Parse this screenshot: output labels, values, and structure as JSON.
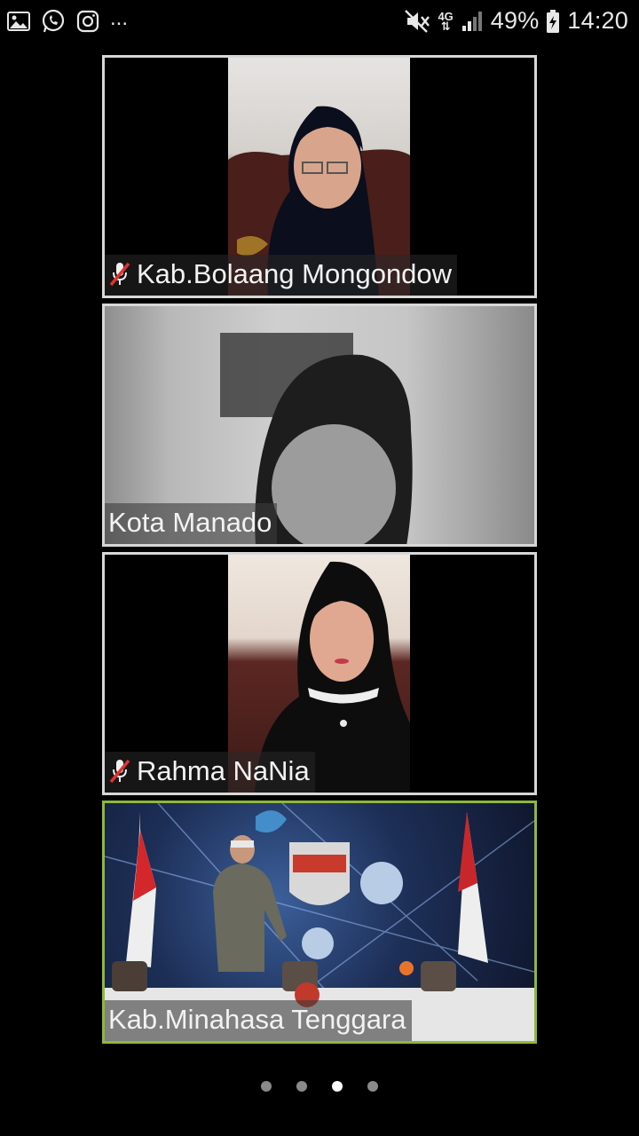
{
  "status_bar": {
    "left_icons": [
      "gallery-icon",
      "whatsapp-icon",
      "instagram-icon"
    ],
    "more": "...",
    "network": "4G",
    "battery": "49%",
    "time": "14:20"
  },
  "participants": [
    {
      "name": "Kab.Bolaang Mongondow",
      "muted": true,
      "active": false
    },
    {
      "name": "Kota Manado",
      "muted": false,
      "active": false
    },
    {
      "name": "Rahma NaNia",
      "muted": true,
      "active": false
    },
    {
      "name": "Kab.Minahasa Tenggara",
      "muted": false,
      "active": true
    }
  ],
  "pager": {
    "pages": 4,
    "current": 3
  },
  "colors": {
    "active_border": "#8db83a",
    "tile_border": "#d7d7d7",
    "background": "#000000"
  }
}
